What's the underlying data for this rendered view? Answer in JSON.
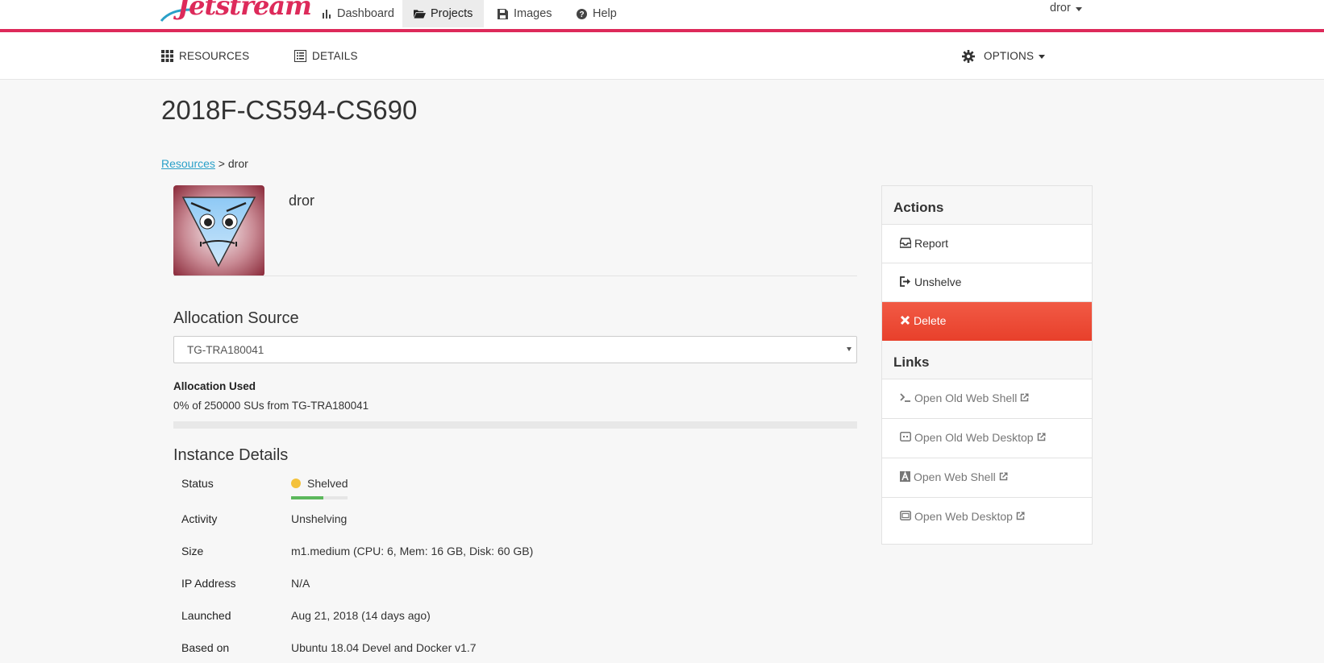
{
  "topnav": {
    "logo_text": "Jetstream",
    "items": [
      {
        "label": "Dashboard",
        "icon": "bar-chart-icon"
      },
      {
        "label": "Projects",
        "icon": "folder-open-icon",
        "active": true
      },
      {
        "label": "Images",
        "icon": "floppy-disk-icon"
      },
      {
        "label": "Help",
        "icon": "question-circle-icon"
      }
    ],
    "user": "dror"
  },
  "subnav": {
    "resources": "RESOURCES",
    "details": "DETAILS",
    "options": "OPTIONS"
  },
  "page": {
    "title": "2018F-CS594-CS690",
    "breadcrumb_link": "Resources",
    "breadcrumb_rest": " > dror"
  },
  "instance": {
    "name": "dror",
    "allocation_heading": "Allocation Source",
    "allocation_selected": "TG-TRA180041",
    "allocation_used_label": "Allocation Used",
    "allocation_used_text": "0% of 250000 SUs from TG-TRA180041",
    "allocation_used_fraction": 0,
    "details_heading": "Instance Details",
    "details": [
      {
        "label": "Status",
        "value": "Shelved"
      },
      {
        "label": "Activity",
        "value": "Unshelving"
      },
      {
        "label": "Size",
        "value": "m1.medium (CPU: 6, Mem: 16 GB, Disk: 60 GB)"
      },
      {
        "label": "IP Address",
        "value": "N/A"
      },
      {
        "label": "Launched",
        "value": "Aug 21, 2018 (14 days ago)"
      },
      {
        "label": "Based on",
        "value": "Ubuntu 18.04 Devel and Docker v1.7"
      }
    ],
    "status_progress_fraction": 0.57
  },
  "actions": {
    "heading": "Actions",
    "items": [
      {
        "label": "Report",
        "icon": "inbox-icon"
      },
      {
        "label": "Unshelve",
        "icon": "sign-out-icon"
      },
      {
        "label": "Delete",
        "icon": "close-icon"
      }
    ]
  },
  "links": {
    "heading": "Links",
    "items": [
      {
        "label": "Open Old Web Shell",
        "icon": "terminal-icon"
      },
      {
        "label": "Open Old Web Desktop",
        "icon": "desktop-icon"
      },
      {
        "label": "Open Web Shell",
        "icon": "guacamole-shell-icon"
      },
      {
        "label": "Open Web Desktop",
        "icon": "guacamole-desktop-icon"
      }
    ]
  },
  "colors": {
    "brand": "#dd2a5a",
    "link": "#2aa0c8",
    "delete": "#e8402b",
    "status_shelved": "#f4c23c",
    "progress": "#5cb85c"
  }
}
